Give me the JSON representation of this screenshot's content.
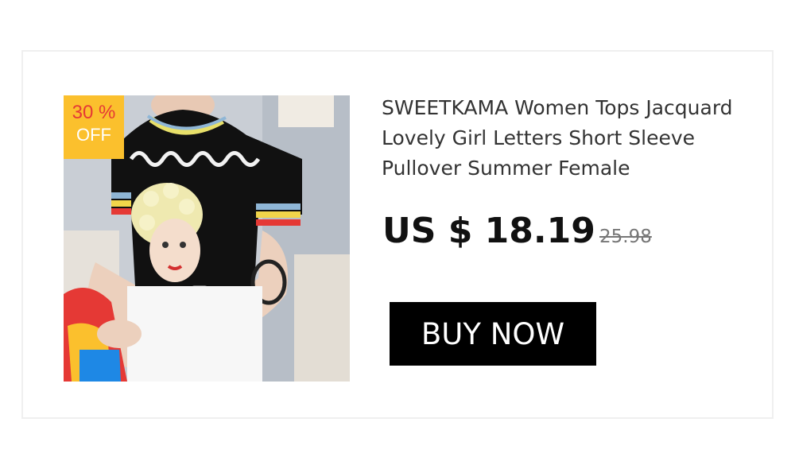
{
  "product": {
    "image_alt": "Woman wearing black knit t-shirt with girl portrait and cursive letters",
    "discount_badge": {
      "percent": "30 %",
      "label": "OFF",
      "color": "#fbc02d"
    },
    "title": "SWEETKAMA Women Tops Jacquard Lovely Girl Letters Short Sleeve Pullover Summer Female",
    "price": "US $ 18.19",
    "original_price": "25.98",
    "buy_button": "BUY NOW"
  }
}
